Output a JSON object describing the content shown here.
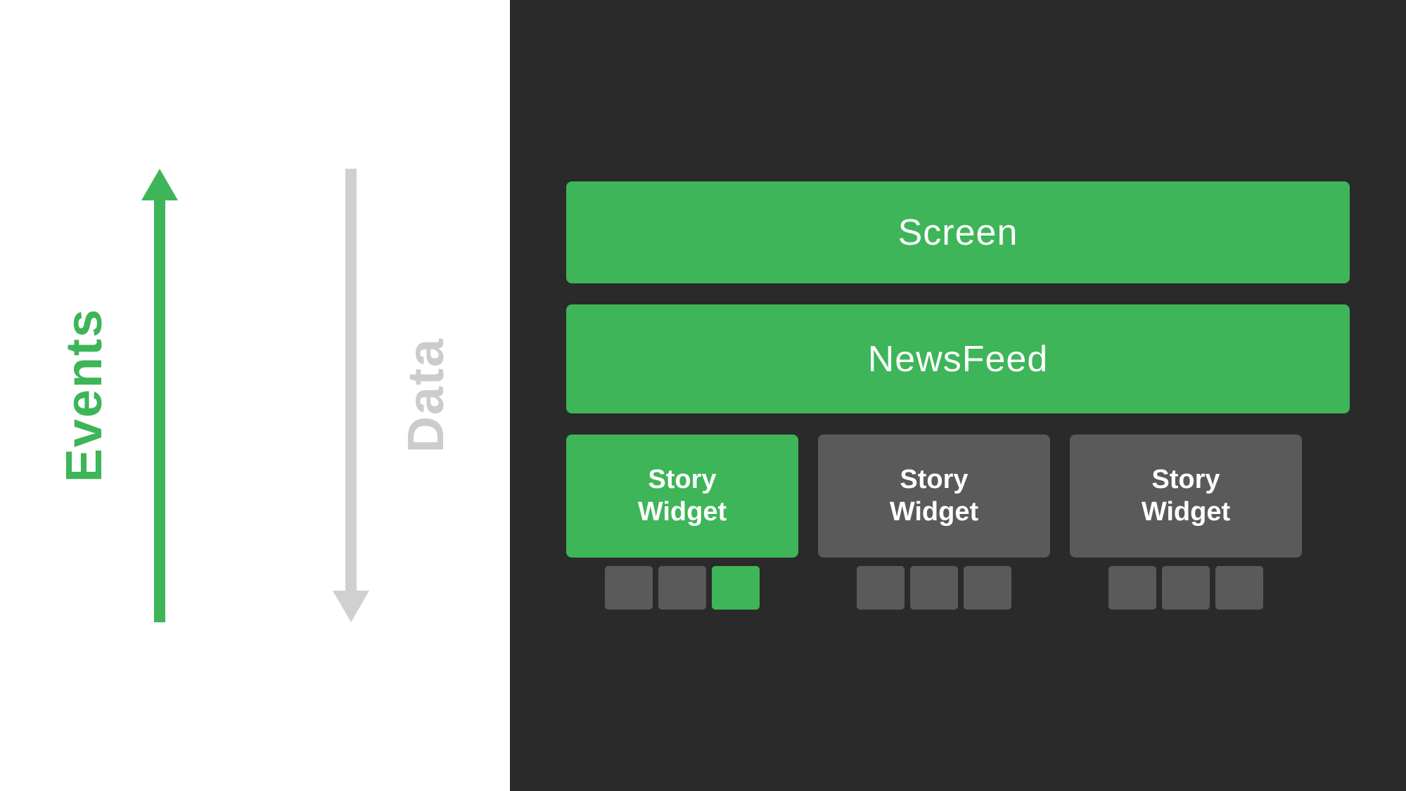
{
  "left": {
    "events_label": "Events",
    "data_label": "Data"
  },
  "right": {
    "screen_label": "Screen",
    "newsfeed_label": "NewsFeed",
    "story_widgets": [
      {
        "label": "Story\nWidget",
        "color": "green",
        "indicators": [
          "gray",
          "gray",
          "green"
        ]
      },
      {
        "label": "Story\nWidget",
        "color": "gray",
        "indicators": [
          "gray",
          "gray",
          "gray"
        ]
      },
      {
        "label": "Story\nWidget",
        "color": "gray",
        "indicators": [
          "gray",
          "gray",
          "gray"
        ]
      }
    ]
  }
}
